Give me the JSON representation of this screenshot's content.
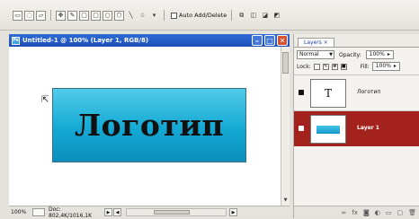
{
  "toolbar": {
    "auto_add_delete_label": "Auto Add/Delete",
    "tools": [
      "rect-select",
      "elliptical",
      "lasso",
      "move",
      "brush",
      "rectangle",
      "rounded-rect",
      "ellipse",
      "polygon",
      "line",
      "custom-shape"
    ]
  },
  "document": {
    "title": "Untitled-1 @ 100% (Layer 1, RGB/8)",
    "canvas_text": "Логотип",
    "zoom": "100%",
    "doc_size": "Doc: 802,4K/1016,1K"
  },
  "layers_panel": {
    "tab_label": "Layers",
    "blend_mode": "Normal",
    "opacity_label": "Opacity:",
    "opacity_value": "100%",
    "lock_label": "Lock:",
    "fill_label": "Fill:",
    "fill_value": "100%",
    "layers": [
      {
        "name": "Логотип",
        "type": "text",
        "thumb_glyph": "T",
        "selected": false
      },
      {
        "name": "Layer 1",
        "type": "raster",
        "selected": true
      }
    ]
  },
  "colors": {
    "title_bar": "#1c4fb6",
    "logo_gradient_top": "#52cbea",
    "logo_gradient_bottom": "#0c8fbb",
    "selected_layer": "#a3221e"
  }
}
